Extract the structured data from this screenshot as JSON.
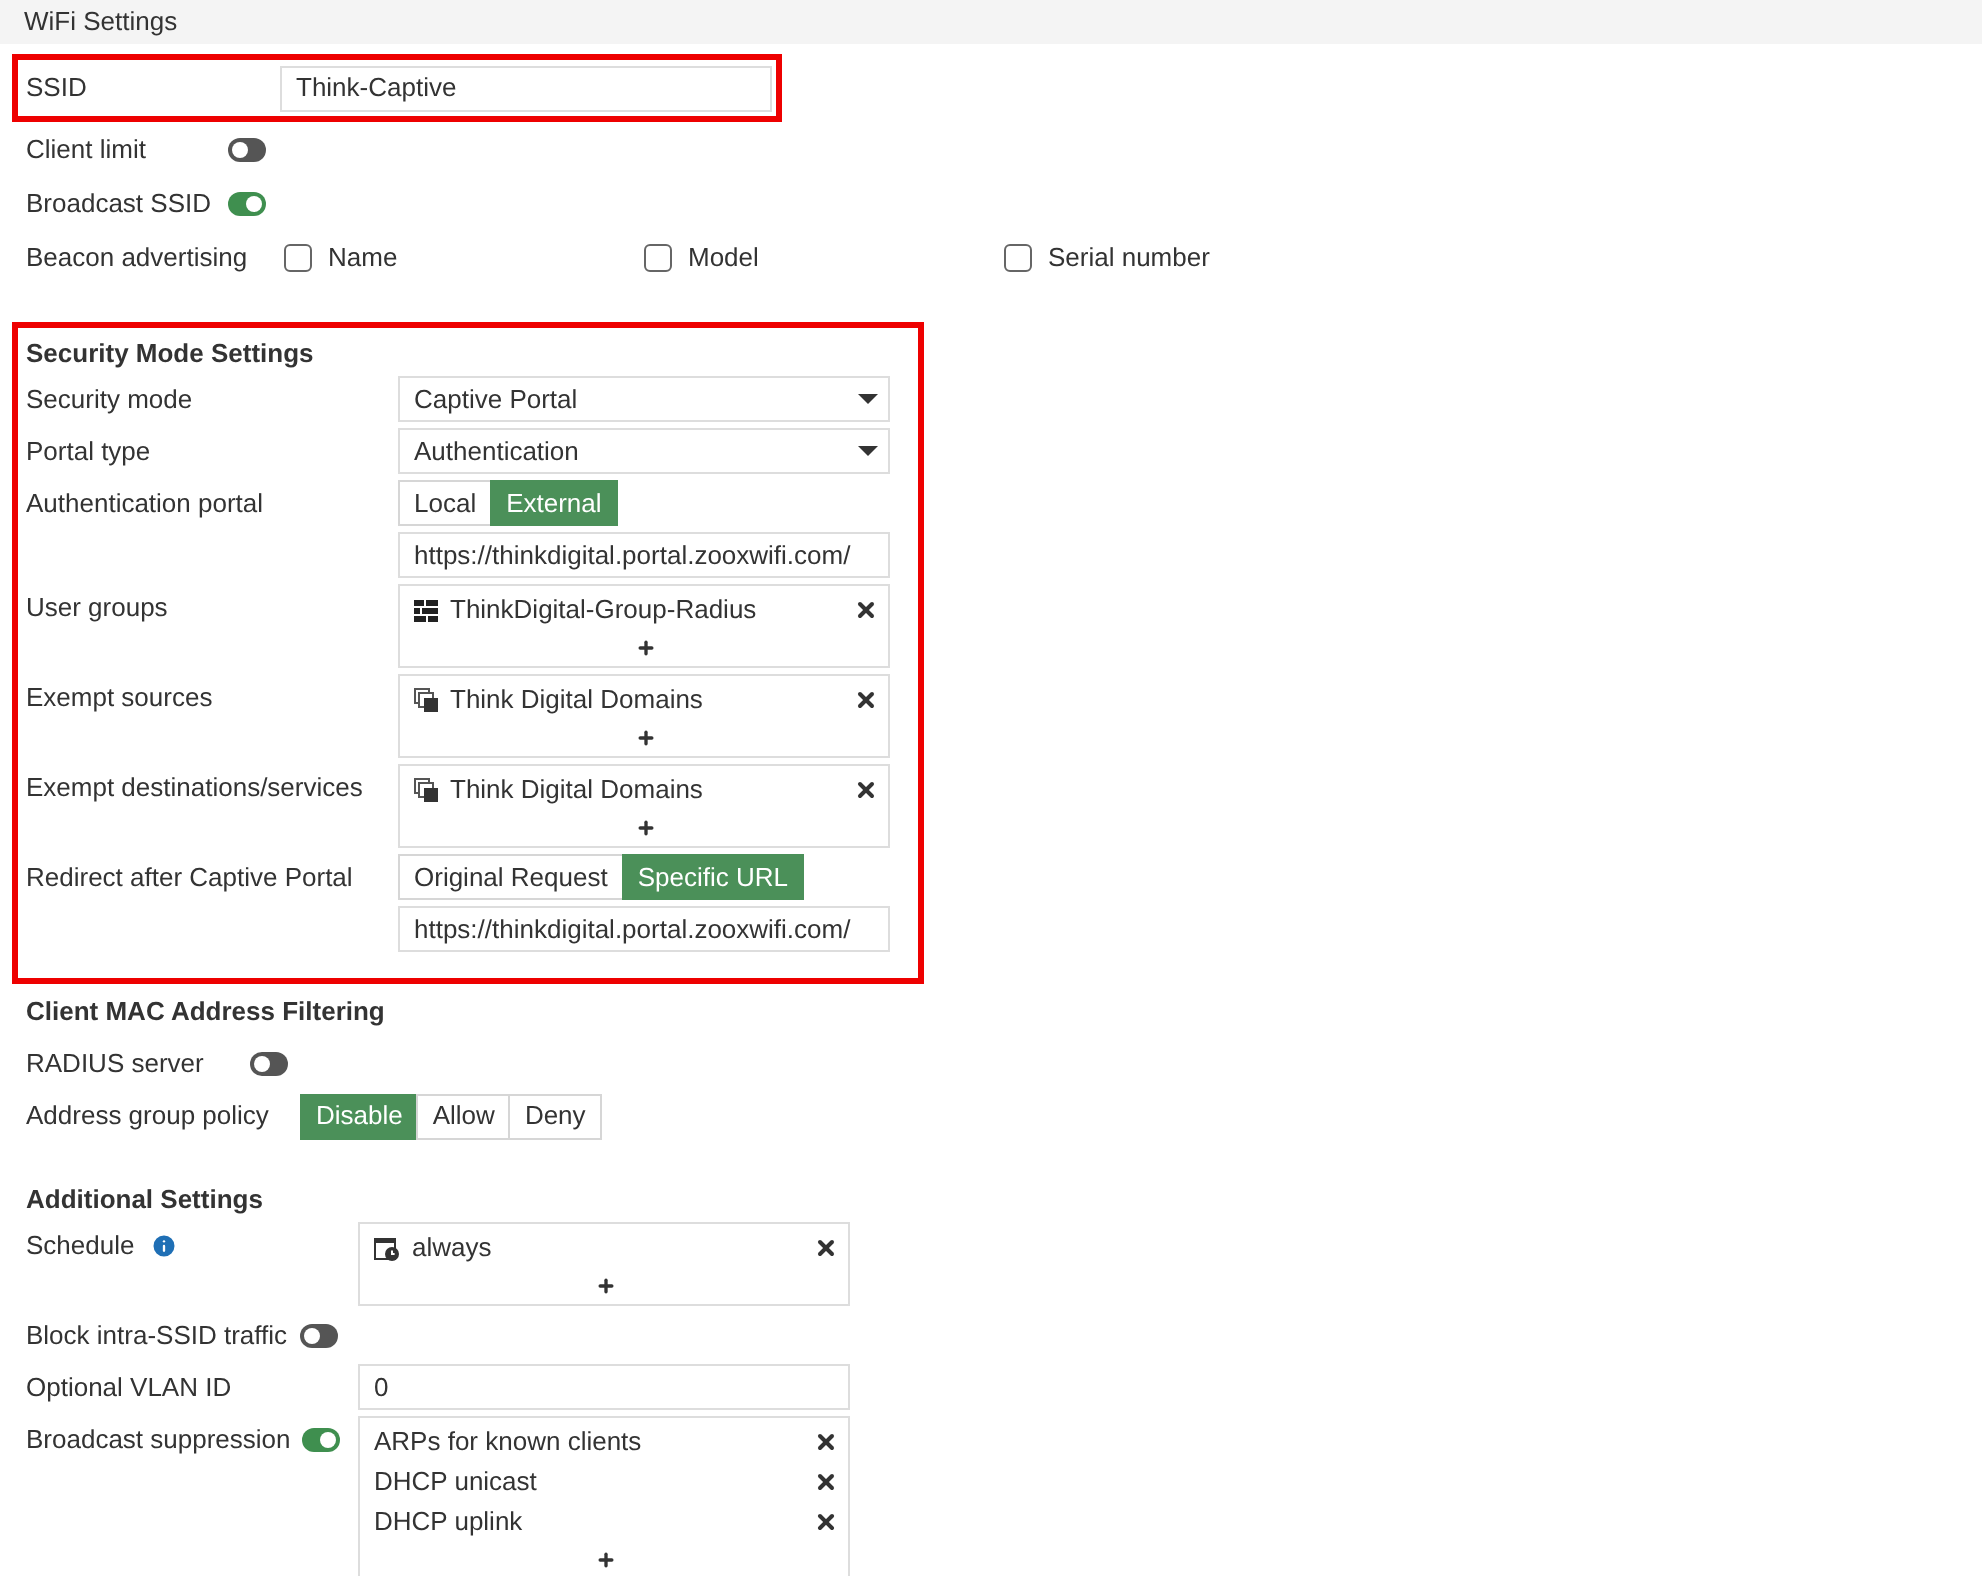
{
  "header": {
    "title": "WiFi Settings"
  },
  "wifi": {
    "ssid": {
      "label": "SSID",
      "value": "Think-Captive"
    },
    "toggles": [
      {
        "label": "Client limit",
        "on": false
      },
      {
        "label": "Broadcast SSID",
        "on": true
      }
    ],
    "beacon_advertising": {
      "label": "Beacon advertising",
      "options": [
        {
          "label": "Name",
          "checked": false
        },
        {
          "label": "Model",
          "checked": false
        },
        {
          "label": "Serial number",
          "checked": false
        }
      ]
    }
  },
  "security": {
    "title": "Security Mode Settings",
    "rows": [
      {
        "kind": "select",
        "label": "Security mode",
        "value": "Captive Portal"
      },
      {
        "kind": "select",
        "label": "Portal type",
        "value": "Authentication"
      },
      {
        "kind": "segmented",
        "label": "Authentication portal",
        "options": [
          {
            "label": "Local",
            "selected": false
          },
          {
            "label": "External",
            "selected": true
          }
        ]
      },
      {
        "kind": "text",
        "value": "https://thinkdigital.portal.zooxwifi.com/"
      },
      {
        "kind": "list",
        "label": "User groups",
        "items": [
          {
            "kind": "user-group",
            "label": "ThinkDigital-Group-Radius"
          }
        ]
      },
      {
        "kind": "list",
        "label": "Exempt sources",
        "items": [
          {
            "kind": "address",
            "label": "Think Digital Domains"
          }
        ]
      },
      {
        "kind": "list",
        "label": "Exempt destinations/services",
        "items": [
          {
            "kind": "address",
            "label": "Think Digital Domains"
          }
        ]
      },
      {
        "kind": "segmented",
        "label": "Redirect after Captive Portal",
        "options": [
          {
            "label": "Original Request",
            "selected": false
          },
          {
            "label": "Specific URL",
            "selected": true
          }
        ]
      },
      {
        "kind": "text",
        "value": "https://thinkdigital.portal.zooxwifi.com/"
      }
    ]
  },
  "mac_filtering": {
    "title": "Client MAC Address Filtering",
    "rows": [
      {
        "kind": "toggle",
        "label": "RADIUS server",
        "on": false
      },
      {
        "kind": "segmented",
        "label": "Address group policy",
        "options": [
          {
            "label": "Disable",
            "selected": true
          },
          {
            "label": "Allow",
            "selected": false
          },
          {
            "label": "Deny",
            "selected": false
          }
        ]
      }
    ]
  },
  "additional": {
    "title": "Additional Settings",
    "rows": [
      {
        "kind": "list",
        "label": "Schedule",
        "info": true,
        "items": [
          {
            "kind": "schedule",
            "label": "always"
          }
        ]
      },
      {
        "kind": "toggle",
        "label": "Block intra-SSID traffic",
        "on": false
      },
      {
        "kind": "text",
        "label": "Optional VLAN ID",
        "value": "0"
      },
      {
        "kind": "list",
        "label": "Broadcast suppression",
        "toggle_on": true,
        "items": [
          {
            "label": "ARPs for known clients"
          },
          {
            "label": "DHCP unicast"
          },
          {
            "label": "DHCP uplink"
          }
        ]
      }
    ]
  }
}
